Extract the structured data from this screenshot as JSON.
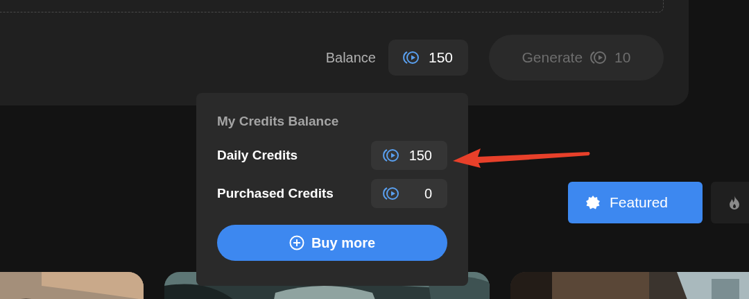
{
  "composer": {
    "balance_label": "Balance",
    "balance": "150",
    "generate": {
      "label": "Generate",
      "cost": "10",
      "disabled": true
    }
  },
  "credits_popover": {
    "title": "My Credits Balance",
    "rows": [
      {
        "label": "Daily Credits",
        "value": "150"
      },
      {
        "label": "Purchased Credits",
        "value": "0"
      }
    ],
    "buy_button": "Buy more"
  },
  "filter_tabs": [
    {
      "kind": "badge",
      "label": "Featured",
      "selected": true
    },
    {
      "kind": "fire",
      "selected": false
    }
  ]
}
